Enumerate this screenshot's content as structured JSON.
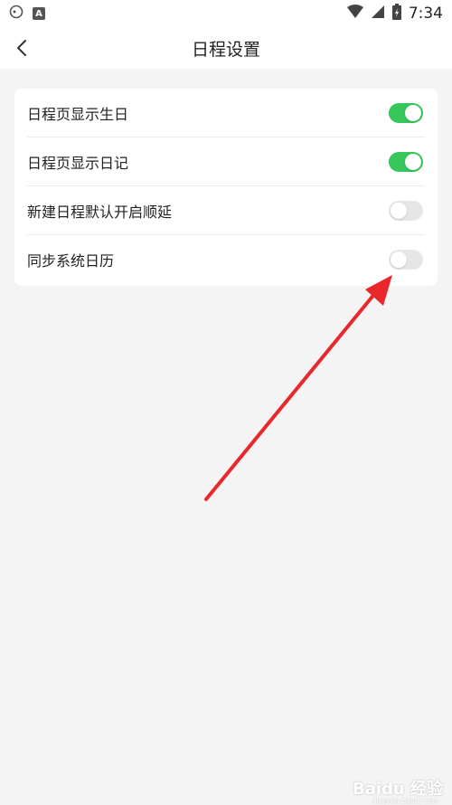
{
  "status_bar": {
    "time": "7:34",
    "app_icon_letter": "A"
  },
  "header": {
    "title": "日程设置"
  },
  "settings": {
    "items": [
      {
        "label": "日程页显示生日",
        "enabled": true
      },
      {
        "label": "日程页显示日记",
        "enabled": true
      },
      {
        "label": "新建日程默认开启顺延",
        "enabled": false
      },
      {
        "label": "同步系统日历",
        "enabled": false
      }
    ]
  },
  "colors": {
    "toggle_on": "#35c759",
    "toggle_off": "#e6e6e6",
    "annotation_arrow": "#e8282b"
  },
  "watermark": {
    "text": "Baidu 经验",
    "url": "jingyan.baidu.com"
  }
}
